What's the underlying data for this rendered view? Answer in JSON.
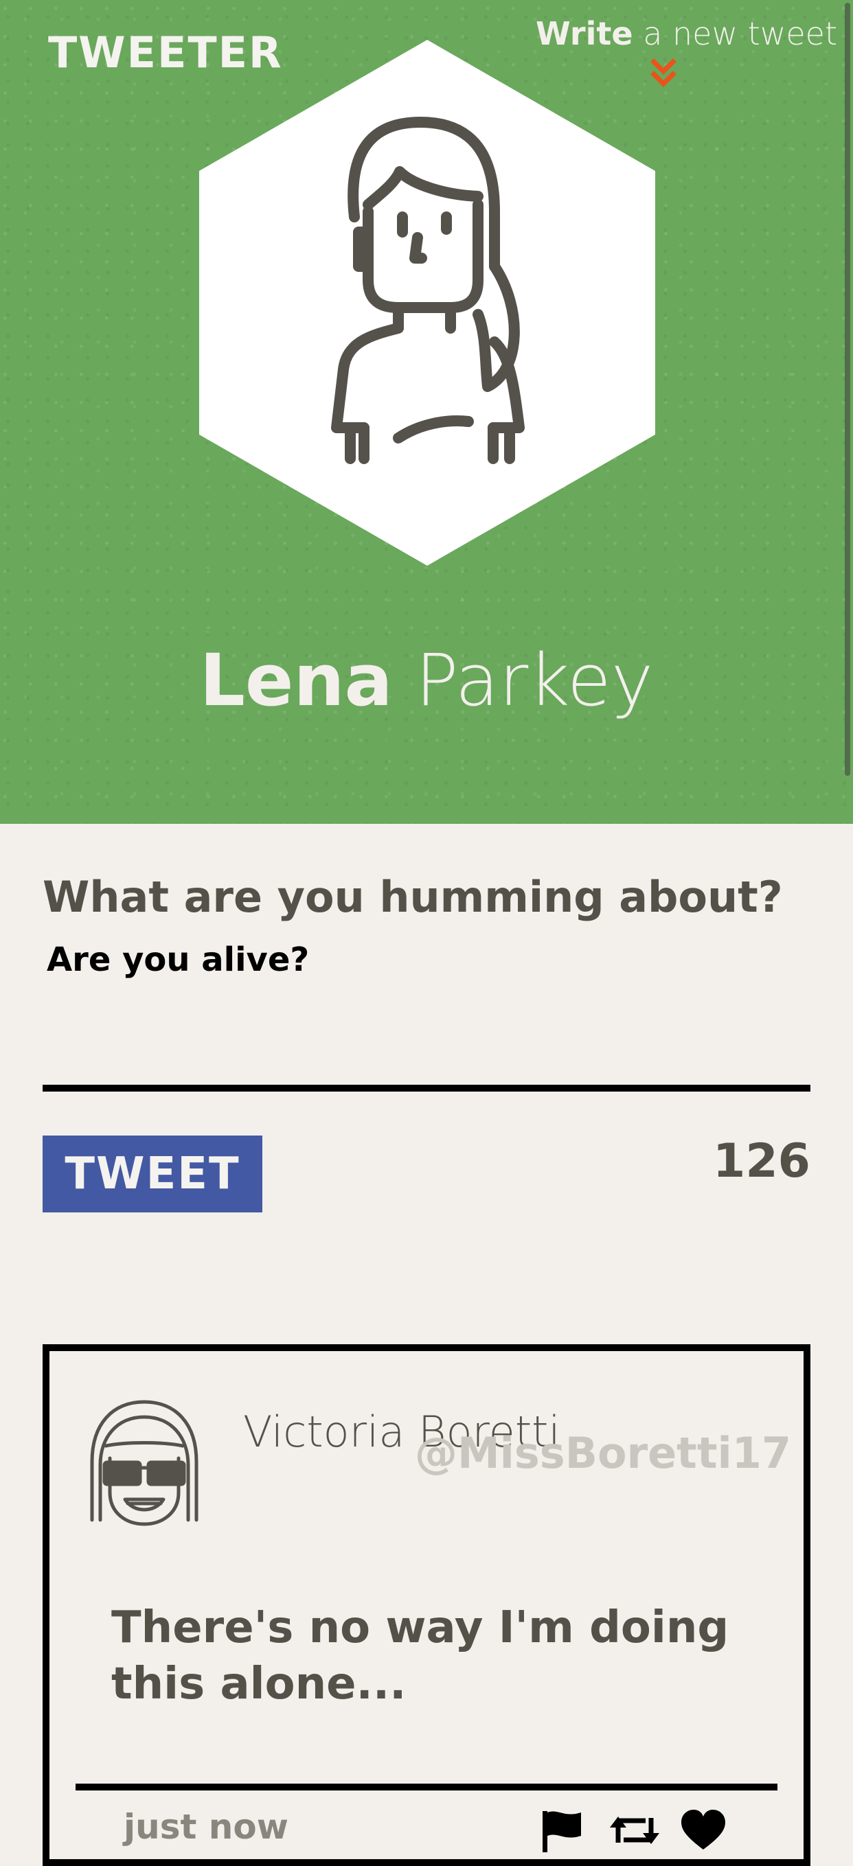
{
  "app": {
    "logo_text": "TWEETER"
  },
  "header": {
    "write_link": {
      "bold": "Write",
      "light": "a new tweet"
    },
    "chevron_icon": "double-chevron-down-icon",
    "chevron_color": "#e8541a",
    "background_color": "#6aa85c",
    "avatar_icon": "woman-avatar-icon",
    "user": {
      "first_name": "Lena",
      "last_name": "Parkey"
    }
  },
  "compose": {
    "prompt": "What are you humming about?",
    "input_value": "Are you alive?",
    "tweet_button_label": "TWEET",
    "tweet_button_color": "#4459a3",
    "char_counter": "126"
  },
  "tweets": [
    {
      "author_name": "Victoria Boretti",
      "handle": "@MissBoretti17",
      "avatar_icon": "woman-sunglasses-avatar-icon",
      "text": "There's no way I'm doing this alone...",
      "timestamp": "just now",
      "actions": [
        "flag-icon",
        "retweet-icon",
        "heart-icon"
      ]
    }
  ]
}
